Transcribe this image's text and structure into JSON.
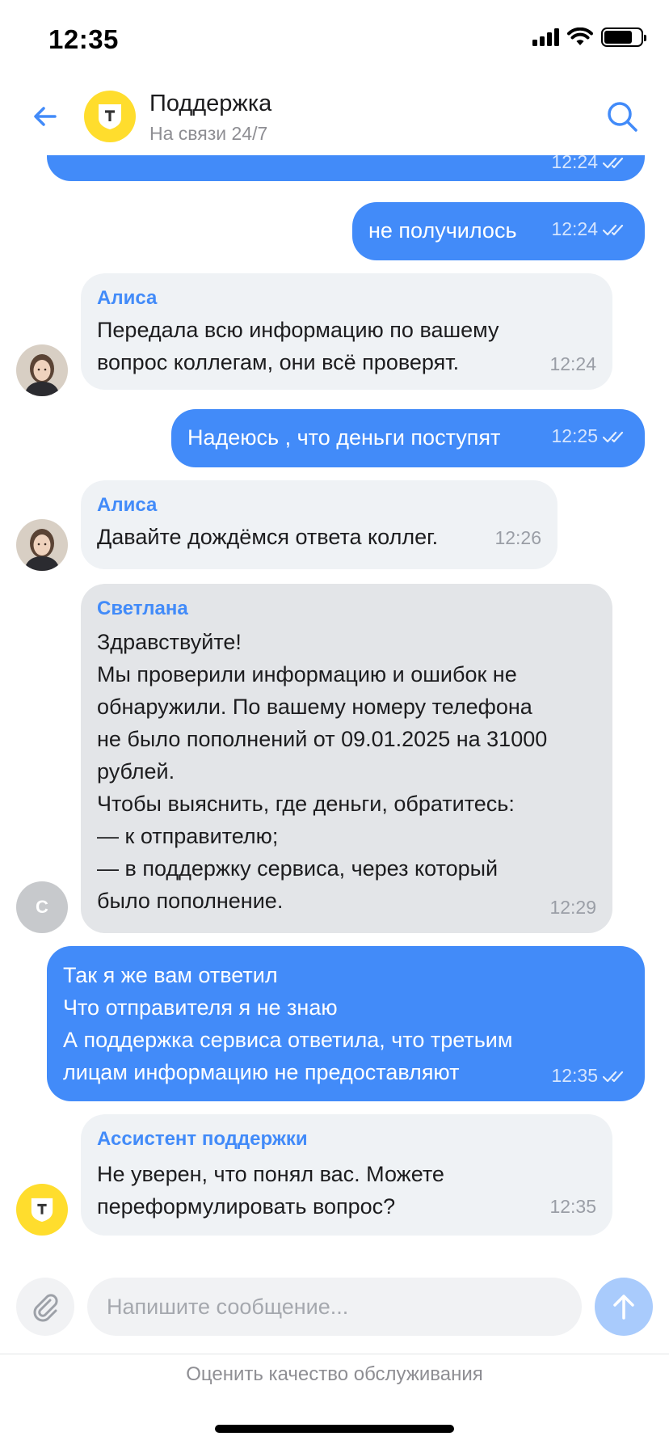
{
  "status_bar": {
    "time": "12:35"
  },
  "header": {
    "title": "Поддержка",
    "subtitle": "На связи 24/7"
  },
  "messages": [
    {
      "direction": "out",
      "text": "",
      "time": "12:24",
      "read": true
    },
    {
      "direction": "out",
      "text": "не получилось",
      "time": "12:24",
      "read": true
    },
    {
      "direction": "in",
      "author": "Алиса",
      "text": "Передала всю информацию по вашему\nвопрос коллегам, они всё проверят.",
      "time": "12:24"
    },
    {
      "direction": "out",
      "text": "Надеюсь , что деньги поступят",
      "time": "12:25",
      "read": true
    },
    {
      "direction": "in",
      "author": "Алиса",
      "text": "Давайте дождёмся ответа коллег.",
      "time": "12:26"
    },
    {
      "direction": "in",
      "author": "Светлана",
      "avatar_initial": "С",
      "text": "Здравствуйте!\nМы проверили информацию и ошибок не\nобнаружили. По вашему номеру телефона\nне было пополнений от 09.01.2025 на 31000\nрублей.\nЧтобы выяснить, где деньги, обратитесь:\n— к отправителю;\n— в поддержку сервиса, через который\nбыло пополнение.",
      "time": "12:29"
    },
    {
      "direction": "out",
      "text": "Так я же вам ответил\nЧто отправителя я не знаю\nА поддержка сервиса ответила, что третьим\nлицам информацию не предоставляют",
      "time": "12:35",
      "read": true
    },
    {
      "direction": "in",
      "author": "Ассистент поддержки",
      "text": "Не уверен, что понял вас. Можете\nпереформулировать вопрос?",
      "time": "12:35"
    }
  ],
  "composer": {
    "placeholder": "Напишите сообщение..."
  },
  "footer": {
    "rate_link": "Оценить качество обслуживания"
  },
  "colors": {
    "outgoing_bubble": "#428bf9",
    "incoming_bubble": "#eff2f5",
    "author_name": "#428bf9",
    "brand_yellow": "#ffdd2d"
  }
}
